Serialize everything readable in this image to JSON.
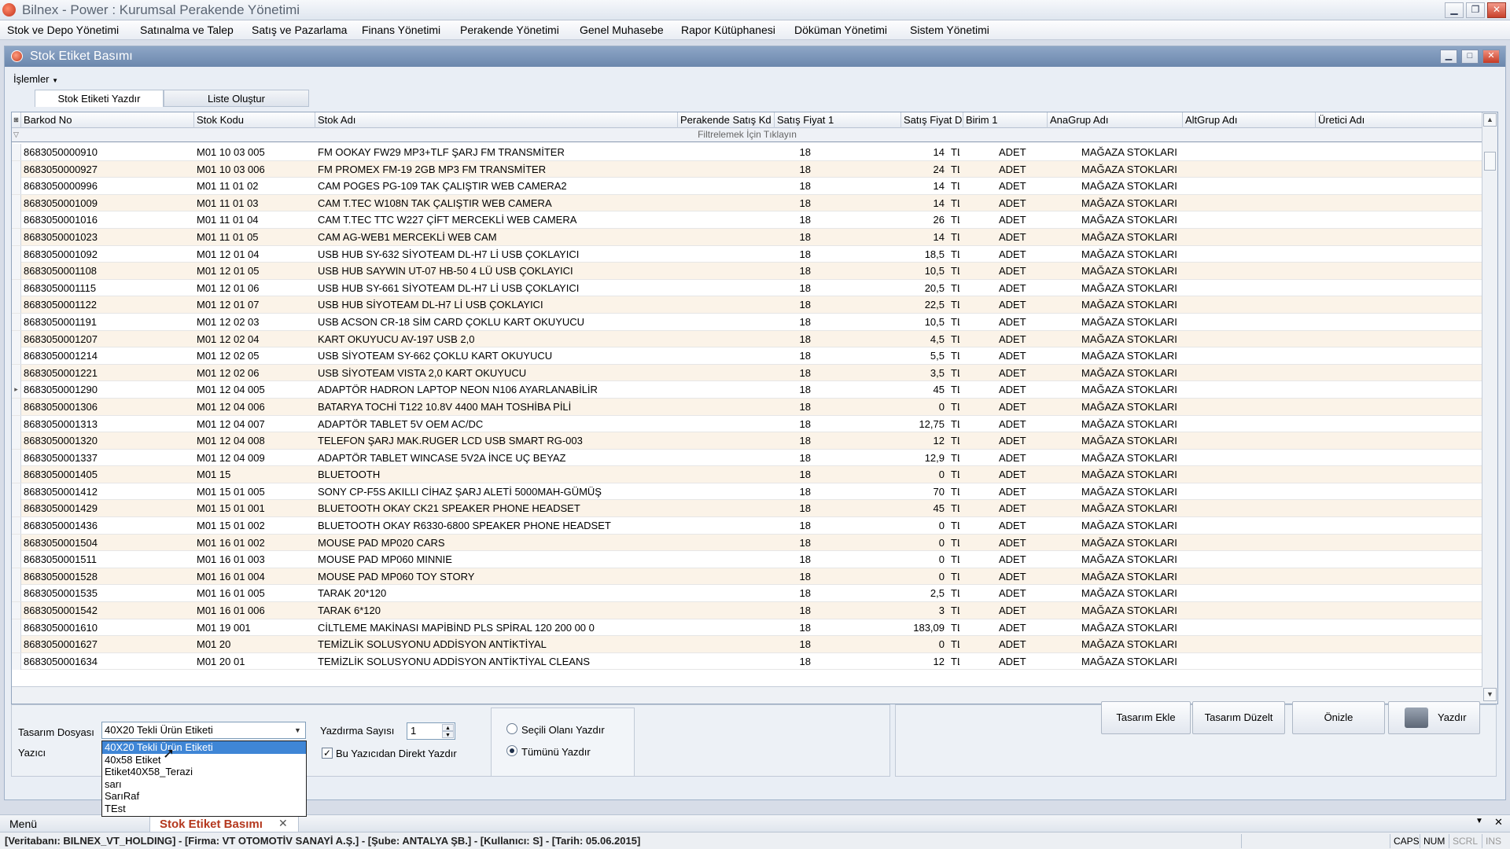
{
  "app": {
    "title": "Bilnex - Power : Kurumsal Perakende Yönetimi"
  },
  "menu": [
    "Stok ve Depo Yönetimi",
    "Satınalma ve Talep",
    "Satış ve Pazarlama",
    "Finans Yönetimi",
    "Perakende Yönetimi",
    "Genel Muhasebe",
    "Rapor Kütüphanesi",
    "Döküman Yönetimi",
    "Sistem Yönetimi"
  ],
  "window": {
    "title": "Stok Etiket Basımı",
    "operations_menu": "İşlemler"
  },
  "tabs": [
    "Stok Etiketi Yazdır",
    "Liste Oluştur"
  ],
  "grid": {
    "columns": [
      "Barkod No",
      "Stok Kodu",
      "Stok Adı",
      "Perakende Satış Kd",
      "Satış Fiyat 1",
      "Satış Fiyat D",
      "Birim 1",
      "AnaGrup Adı",
      "AltGrup Adı",
      "Üretici Adı"
    ],
    "filter_hint": "Filtrelemek İçin Tıklayın",
    "rows": [
      [
        "8683050000910",
        "M01 10 03 005",
        "FM OOKAY FW29 MP3+TLF ŞARJ  FM TRANSMİTER",
        "18",
        "14",
        "TL",
        "ADET",
        "MAĞAZA STOKLARI"
      ],
      [
        "8683050000927",
        "M01 10 03 006",
        "FM PROMEX FM-19 2GB MP3 FM TRANSMİTER",
        "18",
        "24",
        "TL",
        "ADET",
        "MAĞAZA STOKLARI"
      ],
      [
        "8683050000996",
        "M01 11 01 02",
        "CAM POGES PG-109 TAK ÇALIŞTIR WEB CAMERA2",
        "18",
        "14",
        "TL",
        "ADET",
        "MAĞAZA STOKLARI"
      ],
      [
        "8683050001009",
        "M01 11 01 03",
        "CAM T.TEC W108N TAK ÇALIŞTIR WEB CAMERA",
        "18",
        "14",
        "TL",
        "ADET",
        "MAĞAZA STOKLARI"
      ],
      [
        "8683050001016",
        "M01 11 01 04",
        "CAM T.TEC TTC W227 ÇİFT MERCEKLİ WEB CAMERA",
        "18",
        "26",
        "TL",
        "ADET",
        "MAĞAZA STOKLARI"
      ],
      [
        "8683050001023",
        "M01 11 01 05",
        "CAM AG-WEB1 MERCEKLİ WEB CAM",
        "18",
        "14",
        "TL",
        "ADET",
        "MAĞAZA STOKLARI"
      ],
      [
        "8683050001092",
        "M01 12 01 04",
        "USB HUB SY-632 SİYOTEAM DL-H7  Lİ USB ÇOKLAYICI",
        "18",
        "18,5",
        "TL",
        "ADET",
        "MAĞAZA STOKLARI"
      ],
      [
        "8683050001108",
        "M01 12 01 05",
        "USB HUB  SAYWIN UT-07 HB-50 4  LÜ USB ÇOKLAYICI",
        "18",
        "10,5",
        "TL",
        "ADET",
        "MAĞAZA STOKLARI"
      ],
      [
        "8683050001115",
        "M01 12 01 06",
        "USB HUB SY-661 SİYOTEAM DL-H7 Lİ USB ÇOKLAYICI",
        "18",
        "20,5",
        "TL",
        "ADET",
        "MAĞAZA STOKLARI"
      ],
      [
        "8683050001122",
        "M01 12 01 07",
        "USB HUB  SİYOTEAM DL-H7  Lİ USB ÇOKLAYICI",
        "18",
        "22,5",
        "TL",
        "ADET",
        "MAĞAZA STOKLARI"
      ],
      [
        "8683050001191",
        "M01 12 02 03",
        "USB ACSON CR-18 SİM CARD  ÇOKLU KART OKUYUCU",
        "18",
        "10,5",
        "TL",
        "ADET",
        "MAĞAZA STOKLARI"
      ],
      [
        "8683050001207",
        "M01 12 02 04",
        "KART OKUYUCU AV-197 USB 2,0",
        "18",
        "4,5",
        "TL",
        "ADET",
        "MAĞAZA STOKLARI"
      ],
      [
        "8683050001214",
        "M01 12 02 05",
        "USB SİYOTEAM SY-662 ÇOKLU KART OKUYUCU",
        "18",
        "5,5",
        "TL",
        "ADET",
        "MAĞAZA STOKLARI"
      ],
      [
        "8683050001221",
        "M01 12 02 06",
        "USB SİYOTEAM VISTA 2,0 KART OKUYUCU",
        "18",
        "3,5",
        "TL",
        "ADET",
        "MAĞAZA STOKLARI"
      ],
      [
        "8683050001290",
        "M01 12 04 005",
        "ADAPTÖR HADRON LAPTOP NEON N106 AYARLANABİLİR",
        "18",
        "45",
        "TL",
        "ADET",
        "MAĞAZA STOKLARI"
      ],
      [
        "8683050001306",
        "M01 12 04 006",
        "BATARYA TOCHİ T122 10.8V 4400 MAH TOSHİBA PİLİ",
        "18",
        "0",
        "TL",
        "ADET",
        "MAĞAZA STOKLARI"
      ],
      [
        "8683050001313",
        "M01 12 04 007",
        "ADAPTÖR TABLET 5V OEM AC/DC",
        "18",
        "12,75",
        "TL",
        "ADET",
        "MAĞAZA STOKLARI"
      ],
      [
        "8683050001320",
        "M01 12 04 008",
        "TELEFON ŞARJ MAK.RUGER LCD USB SMART RG-003",
        "18",
        "12",
        "TL",
        "ADET",
        "MAĞAZA STOKLARI"
      ],
      [
        "8683050001337",
        "M01 12 04 009",
        "ADAPTÖR TABLET WINCASE 5V2A İNCE UÇ BEYAZ",
        "18",
        "12,9",
        "TL",
        "ADET",
        "MAĞAZA STOKLARI"
      ],
      [
        "8683050001405",
        "M01 15",
        "BLUETOOTH",
        "18",
        "0",
        "TL",
        "ADET",
        "MAĞAZA STOKLARI"
      ],
      [
        "8683050001412",
        "M01 15 01  005",
        "SONY CP-F5S AKILLI CİHAZ ŞARJ ALETİ 5000MAH-GÜMÜŞ",
        "18",
        "70",
        "TL",
        "ADET",
        "MAĞAZA STOKLARI"
      ],
      [
        "8683050001429",
        "M01 15 01 001",
        "BLUETOOTH OKAY CK21 SPEAKER PHONE HEADSET",
        "18",
        "45",
        "TL",
        "ADET",
        "MAĞAZA STOKLARI"
      ],
      [
        "8683050001436",
        "M01 15 01 002",
        "BLUETOOTH OKAY R6330-6800 SPEAKER PHONE HEADSET",
        "18",
        "0",
        "TL",
        "ADET",
        "MAĞAZA STOKLARI"
      ],
      [
        "8683050001504",
        "M01 16 01 002",
        "MOUSE PAD MP020 CARS",
        "18",
        "0",
        "TL",
        "ADET",
        "MAĞAZA STOKLARI"
      ],
      [
        "8683050001511",
        "M01 16 01 003",
        "MOUSE PAD MP060 MINNIE",
        "18",
        "0",
        "TL",
        "ADET",
        "MAĞAZA STOKLARI"
      ],
      [
        "8683050001528",
        "M01 16 01 004",
        "MOUSE PAD MP060 TOY STORY",
        "18",
        "0",
        "TL",
        "ADET",
        "MAĞAZA STOKLARI"
      ],
      [
        "8683050001535",
        "M01 16 01 005",
        "TARAK 20*120",
        "18",
        "2,5",
        "TL",
        "ADET",
        "MAĞAZA STOKLARI"
      ],
      [
        "8683050001542",
        "M01 16 01 006",
        "TARAK 6*120",
        "18",
        "3",
        "TL",
        "ADET",
        "MAĞAZA STOKLARI"
      ],
      [
        "8683050001610",
        "M01 19 001",
        "CİLTLEME MAKİNASI MAPİBİND PLS SPİRAL 120 200 00 0",
        "18",
        "183,09",
        "TL",
        "ADET",
        "MAĞAZA STOKLARI"
      ],
      [
        "8683050001627",
        "M01 20",
        "TEMİZLİK SOLUSYONU ADDİSYON ANTİKTİYAL",
        "18",
        "0",
        "TL",
        "ADET",
        "MAĞAZA STOKLARI"
      ],
      [
        "8683050001634",
        "M01 20 01",
        "TEMİZLİK SOLUSYONU ADDİSYON ANTİKTİYAL CLEANS",
        "18",
        "12",
        "TL",
        "ADET",
        "MAĞAZA STOKLARI"
      ]
    ]
  },
  "print": {
    "design_file_label": "Tasarım Dosyası",
    "design_file_value": "40X20 Tekli Ürün Etiketi",
    "printer_label": "Yazıcı",
    "design_options": [
      "40X20 Tekli Ürün Etiketi",
      "40x58 Etiket",
      "Etiket40X58_Terazi",
      "sarı",
      "SarıRaf",
      "TEst"
    ],
    "copies_label": "Yazdırma Sayısı",
    "copies_value": "1",
    "direct_print_label": "Bu Yazıcıdan Direkt Yazdır",
    "radio_selected": "Seçili Olanı Yazdır",
    "radio_all": "Tümünü Yazdır",
    "buttons": {
      "add_design": "Tasarım Ekle",
      "edit_design": "Tasarım Düzelt",
      "preview": "Önizle",
      "print": "Yazdır"
    }
  },
  "taskbar": {
    "menu": "Menü",
    "active_tab": "Stok Etiket Basımı"
  },
  "status": {
    "text": "[Veritabanı: BILNEX_VT_HOLDING] - [Firma: VT OTOMOTİV SANAYİ A.Ş.] - [Şube: ANTALYA ŞB.] - [Kullanıcı: S] - [Tarih: 05.06.2015]",
    "indicators": [
      "CAPS",
      "NUM",
      "SCRL",
      "INS"
    ]
  }
}
